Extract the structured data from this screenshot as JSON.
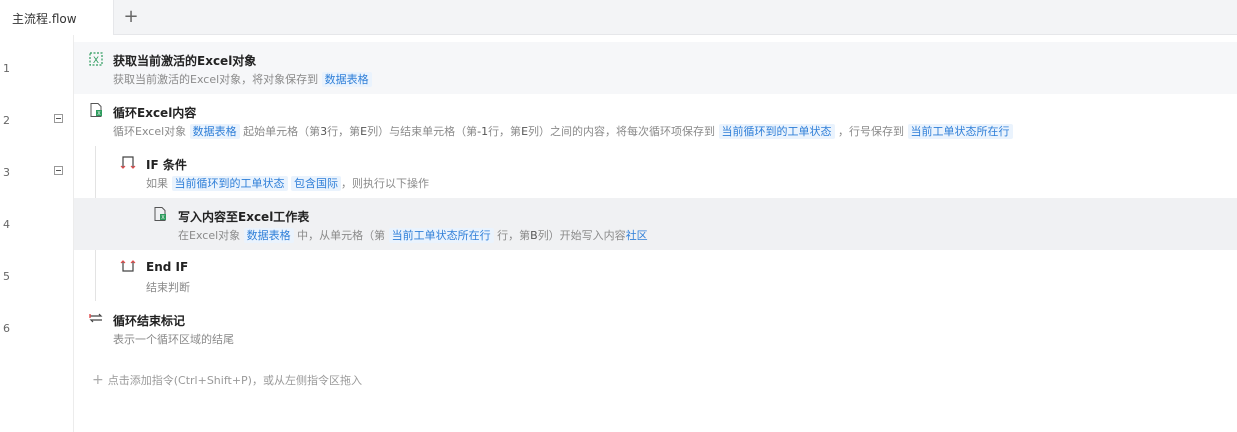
{
  "tabs": {
    "active": "主流程.flow",
    "add_icon": "plus-icon"
  },
  "line_numbers": [
    "1",
    "2",
    "3",
    "4",
    "5",
    "6"
  ],
  "steps": {
    "s1": {
      "title": "获取当前激活的Excel对象",
      "d1": "获取当前激活的Excel对象，将对象保存到",
      "v1": "数据表格",
      "icon": "excel-get-icon"
    },
    "s2": {
      "title": "循环Excel内容",
      "d1": "循环Excel对象",
      "v1": "数据表格",
      "d2": "起始单元格（第",
      "n1": "3",
      "d3": "行，第",
      "n2": "E",
      "d4": "列）与结束单元格（第",
      "n3": "-1",
      "d5": "行，第",
      "n4": "E",
      "d6": "列）之间的内容，将每次循环项保存到",
      "v2": "当前循环到的工单状态",
      "d7": "，行号保存到",
      "v3": "当前工单状态所在行",
      "icon": "excel-loop-icon"
    },
    "s3": {
      "title": "IF 条件",
      "d1": "如果",
      "v1": "当前循环到的工单状态",
      "v2": "包含国际",
      "d2": "，则执行以下操作",
      "icon": "if-icon"
    },
    "s4": {
      "title": "写入内容至Excel工作表",
      "d1": "在Excel对象",
      "v1": "数据表格",
      "d2": "中，从单元格（第",
      "v2": "当前工单状态所在行",
      "d3": "行，第",
      "n1": "B",
      "d4": "列）开始写入内容",
      "v3": "社区",
      "icon": "excel-write-icon"
    },
    "s5": {
      "title": "End IF",
      "d1": "结束判断",
      "icon": "end-if-icon"
    },
    "s6": {
      "title": "循环结束标记",
      "d1": "表示一个循环区域的结尾",
      "icon": "loop-end-icon"
    }
  },
  "add_command": "点击添加指令(Ctrl+Shift+P)，或从左侧指令区拖入",
  "colors": {
    "accent": "#2f7fd8",
    "variable_bg": "#eaf3fd"
  }
}
